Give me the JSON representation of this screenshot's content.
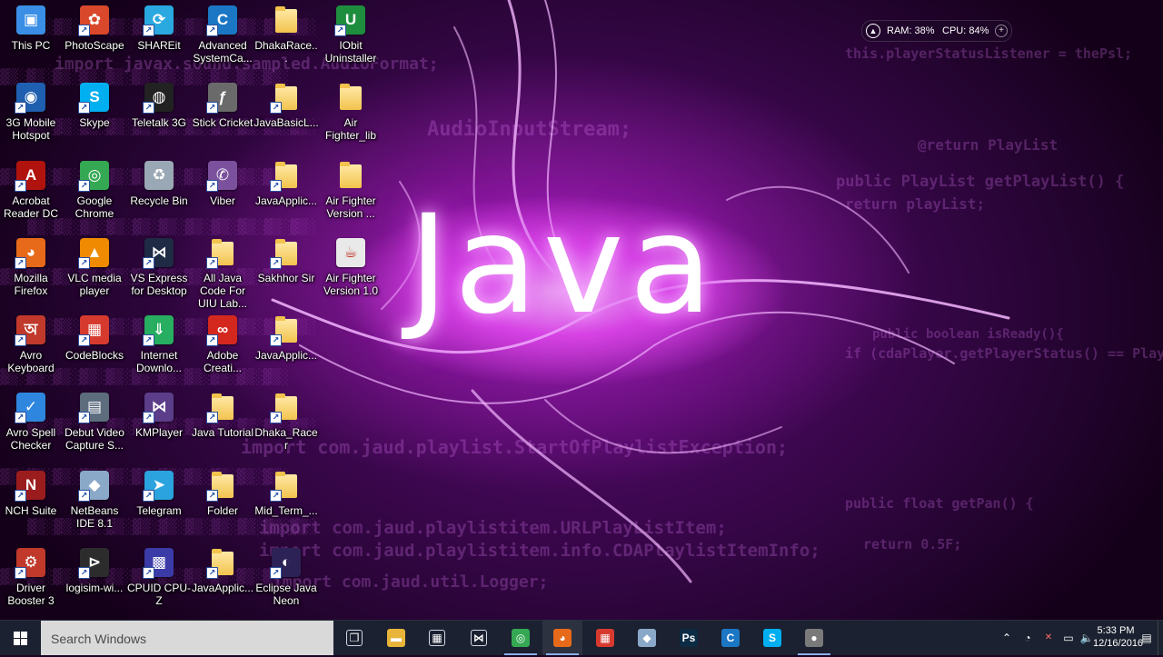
{
  "desktop": {
    "icons": [
      {
        "label": "This PC",
        "icon": "computer-icon",
        "color": "#3a8ee6",
        "glyph": "▣",
        "col": 0,
        "row": 0,
        "shortcut": false
      },
      {
        "label": "3G Mobile Hotspot",
        "icon": "hotspot-icon",
        "color": "#1f5fb0",
        "glyph": "◉",
        "col": 0,
        "row": 1,
        "shortcut": true
      },
      {
        "label": "Acrobat Reader DC",
        "icon": "acrobat-icon",
        "color": "#b0130e",
        "glyph": "A",
        "col": 0,
        "row": 2,
        "shortcut": true
      },
      {
        "label": "Mozilla Firefox",
        "icon": "firefox-icon",
        "color": "#e66a1a",
        "glyph": "◕",
        "col": 0,
        "row": 3,
        "shortcut": true
      },
      {
        "label": "Avro Keyboard",
        "icon": "avro-keyboard-icon",
        "color": "#c0392b",
        "glyph": "অ",
        "col": 0,
        "row": 4,
        "shortcut": true
      },
      {
        "label": "Avro Spell Checker",
        "icon": "spell-checker-icon",
        "color": "#2e86de",
        "glyph": "✓",
        "col": 0,
        "row": 5,
        "shortcut": true
      },
      {
        "label": "NCH Suite",
        "icon": "nch-suite-icon",
        "color": "#9b1c1c",
        "glyph": "N",
        "col": 0,
        "row": 6,
        "shortcut": true
      },
      {
        "label": "Driver Booster 3",
        "icon": "driver-booster-icon",
        "color": "#c0392b",
        "glyph": "⚙",
        "col": 0,
        "row": 7,
        "shortcut": true
      },
      {
        "label": "PhotoScape",
        "icon": "photoscape-icon",
        "color": "#d9482b",
        "glyph": "✿",
        "col": 1,
        "row": 0,
        "shortcut": true
      },
      {
        "label": "Skype",
        "icon": "skype-icon",
        "color": "#00aff0",
        "glyph": "S",
        "col": 1,
        "row": 1,
        "shortcut": true
      },
      {
        "label": "Google Chrome",
        "icon": "chrome-icon",
        "color": "#34a853",
        "glyph": "◎",
        "col": 1,
        "row": 2,
        "shortcut": true
      },
      {
        "label": "VLC media player",
        "icon": "vlc-icon",
        "color": "#f08a00",
        "glyph": "▲",
        "col": 1,
        "row": 3,
        "shortcut": true
      },
      {
        "label": "CodeBlocks",
        "icon": "codeblocks-icon",
        "color": "#d63a2f",
        "glyph": "▦",
        "col": 1,
        "row": 4,
        "shortcut": true
      },
      {
        "label": "Debut Video Capture S...",
        "icon": "debut-video-icon",
        "color": "#5d6d7e",
        "glyph": "▤",
        "col": 1,
        "row": 5,
        "shortcut": true
      },
      {
        "label": "NetBeans IDE 8.1",
        "icon": "netbeans-icon",
        "color": "#8aa9c9",
        "glyph": "◆",
        "col": 1,
        "row": 6,
        "shortcut": true
      },
      {
        "label": "logisim-wi...",
        "icon": "logisim-icon",
        "color": "#2c2c2c",
        "glyph": "⊳",
        "col": 1,
        "row": 7,
        "shortcut": true
      },
      {
        "label": "SHAREit",
        "icon": "shareit-icon",
        "color": "#2aa8e0",
        "glyph": "⟳",
        "col": 2,
        "row": 0,
        "shortcut": true
      },
      {
        "label": "Teletalk 3G",
        "icon": "teletalk-icon",
        "color": "#222222",
        "glyph": "◍",
        "col": 2,
        "row": 1,
        "shortcut": true
      },
      {
        "label": "Recycle Bin",
        "icon": "recycle-bin-icon",
        "color": "#9aa7b4",
        "glyph": "♻",
        "col": 2,
        "row": 2,
        "shortcut": false
      },
      {
        "label": "VS Express for Desktop",
        "icon": "visual-studio-icon",
        "color": "#1f2a44",
        "glyph": "⋈",
        "col": 2,
        "row": 3,
        "shortcut": true
      },
      {
        "label": "Internet Downlo...",
        "icon": "internet-download-icon",
        "color": "#27ae60",
        "glyph": "⇓",
        "col": 2,
        "row": 4,
        "shortcut": true
      },
      {
        "label": "KMPlayer",
        "icon": "kmplayer-icon",
        "color": "#5c3d8a",
        "glyph": "⋈",
        "col": 2,
        "row": 5,
        "shortcut": true
      },
      {
        "label": "Telegram",
        "icon": "telegram-icon",
        "color": "#2aa3de",
        "glyph": "➤",
        "col": 2,
        "row": 6,
        "shortcut": true
      },
      {
        "label": "CPUID CPU-Z",
        "icon": "cpuz-icon",
        "color": "#3b3ba8",
        "glyph": "▩",
        "col": 2,
        "row": 7,
        "shortcut": true
      },
      {
        "label": "Advanced SystemCa...",
        "icon": "advanced-systemcare-icon",
        "color": "#1b77c4",
        "glyph": "C",
        "col": 3,
        "row": 0,
        "shortcut": true
      },
      {
        "label": "Stick Cricket",
        "icon": "flash-icon",
        "color": "#6a6a6a",
        "glyph": "ƒ",
        "col": 3,
        "row": 1,
        "shortcut": true
      },
      {
        "label": "Viber",
        "icon": "viber-icon",
        "color": "#7b519d",
        "glyph": "✆",
        "col": 3,
        "row": 2,
        "shortcut": true
      },
      {
        "label": "All Java Code For UIU Lab...",
        "icon": "folder-icon",
        "color": "folder",
        "glyph": "",
        "col": 3,
        "row": 3,
        "shortcut": true
      },
      {
        "label": "Adobe Creati...",
        "icon": "adobe-creative-cloud-icon",
        "color": "#d4281f",
        "glyph": "∞",
        "col": 3,
        "row": 4,
        "shortcut": true
      },
      {
        "label": "Java Tutorial",
        "icon": "folder-icon",
        "color": "folder",
        "glyph": "",
        "col": 3,
        "row": 5,
        "shortcut": true
      },
      {
        "label": "Folder",
        "icon": "folder-icon",
        "color": "folder",
        "glyph": "",
        "col": 3,
        "row": 6,
        "shortcut": true
      },
      {
        "label": "JavaApplic...",
        "icon": "folder-icon",
        "color": "folder",
        "glyph": "",
        "col": 3,
        "row": 7,
        "shortcut": true
      },
      {
        "label": "DhakaRace...",
        "icon": "folder-icon",
        "color": "folder",
        "glyph": "",
        "col": 4,
        "row": 0,
        "shortcut": false
      },
      {
        "label": "JavaBasicL...",
        "icon": "folder-icon",
        "color": "folder",
        "glyph": "",
        "col": 4,
        "row": 1,
        "shortcut": true
      },
      {
        "label": "JavaApplic...",
        "icon": "folder-icon",
        "color": "folder",
        "glyph": "",
        "col": 4,
        "row": 2,
        "shortcut": true
      },
      {
        "label": "Sakhhor Sir",
        "icon": "folder-icon",
        "color": "folder",
        "glyph": "",
        "col": 4,
        "row": 3,
        "shortcut": true
      },
      {
        "label": "JavaApplic...",
        "icon": "folder-icon",
        "color": "folder",
        "glyph": "",
        "col": 4,
        "row": 4,
        "shortcut": true
      },
      {
        "label": "Dhaka_Racer",
        "icon": "folder-icon",
        "color": "folder",
        "glyph": "",
        "col": 4,
        "row": 5,
        "shortcut": true
      },
      {
        "label": "Mid_Term_...",
        "icon": "folder-icon",
        "color": "folder",
        "glyph": "",
        "col": 4,
        "row": 6,
        "shortcut": true
      },
      {
        "label": "Eclipse Java Neon",
        "icon": "eclipse-icon",
        "color": "#2c2255",
        "glyph": "◐",
        "col": 4,
        "row": 7,
        "shortcut": true
      },
      {
        "label": "IObit Uninstaller",
        "icon": "iobit-uninstaller-icon",
        "color": "#1e8e3e",
        "glyph": "U",
        "col": 5,
        "row": 0,
        "shortcut": true
      },
      {
        "label": "Air Fighter_lib",
        "icon": "folder-icon",
        "color": "folder",
        "glyph": "",
        "col": 5,
        "row": 1,
        "shortcut": false
      },
      {
        "label": "Air Fighter Version ...",
        "icon": "folder-icon",
        "color": "folder",
        "glyph": "",
        "col": 5,
        "row": 2,
        "shortcut": false
      },
      {
        "label": "Air Fighter Version 1.0",
        "icon": "java-jar-icon",
        "color": "#e9e9e9",
        "glyph": "☕",
        "col": 5,
        "row": 3,
        "shortcut": false
      }
    ]
  },
  "sysmon": {
    "ram": "RAM: 38%",
    "cpu": "CPU: 84%"
  },
  "taskbar": {
    "search_placeholder": "Search Windows",
    "pinned": [
      {
        "name": "task-view",
        "icon": "task-view-icon",
        "glyph": "❐",
        "color": "transparent"
      },
      {
        "name": "file-explorer",
        "icon": "file-explorer-icon",
        "glyph": "▬",
        "color": "#e8b43a"
      },
      {
        "name": "store",
        "icon": "store-icon",
        "glyph": "▦",
        "color": "transparent"
      },
      {
        "name": "visual-studio",
        "icon": "visual-studio-icon",
        "glyph": "⋈",
        "color": "transparent"
      },
      {
        "name": "chrome",
        "icon": "chrome-icon",
        "glyph": "◎",
        "color": "#34a853"
      },
      {
        "name": "firefox",
        "icon": "firefox-icon",
        "glyph": "◕",
        "color": "#e66a1a"
      },
      {
        "name": "codeblocks",
        "icon": "codeblocks-icon",
        "glyph": "▦",
        "color": "#d63a2f"
      },
      {
        "name": "netbeans",
        "icon": "netbeans-icon",
        "glyph": "◆",
        "color": "#8aa9c9"
      },
      {
        "name": "photoshop",
        "icon": "photoshop-icon",
        "glyph": "Ps",
        "color": "#0c2b44"
      },
      {
        "name": "advanced-systemcare",
        "icon": "advanced-systemcare-icon",
        "glyph": "C",
        "color": "#1b77c4"
      },
      {
        "name": "skype",
        "icon": "skype-icon",
        "glyph": "S",
        "color": "#00aff0"
      },
      {
        "name": "screen-recorder",
        "icon": "screen-recorder-icon",
        "glyph": "●",
        "color": "#7a7a7a"
      }
    ],
    "tray": [
      {
        "name": "show-hidden-icons",
        "icon": "chevron-up-icon",
        "glyph": "⌃"
      },
      {
        "name": "network-status",
        "icon": "network-icon",
        "glyph": "◔"
      },
      {
        "name": "network-warning",
        "icon": "network-warning-icon",
        "glyph": "✕"
      },
      {
        "name": "battery",
        "icon": "battery-icon",
        "glyph": "▭"
      },
      {
        "name": "volume",
        "icon": "speaker-icon",
        "glyph": "🔈"
      },
      {
        "name": "action-center",
        "icon": "notification-icon",
        "glyph": "▤"
      }
    ],
    "time": "5:33 PM",
    "date": "12/16/2016"
  },
  "wallpaper": {
    "word": "Java",
    "code_lines": [
      "this.playerStatusListener = thePsl;",
      "@return PlayList",
      "public PlayList getPlayList() {",
      "return playList;",
      "public boolean isReady(){",
      "if (cdaPlayer.getPlayerStatus() == PlayerStatus.PLAYING){",
      "import com.jaud.playlist.StartOfPlaylistException;",
      "import com.jaud.playlistitem.URLPlayListItem;",
      "import com.jaud.playlistitem.info.CDAPlaylistItemInfo;",
      "import com.jaud.util.Logger;",
      "import javax.sound.sampled.AudioFormat;",
      "AudioInputStream;",
      "public float getPan() {",
      "return 0.5F;"
    ]
  }
}
